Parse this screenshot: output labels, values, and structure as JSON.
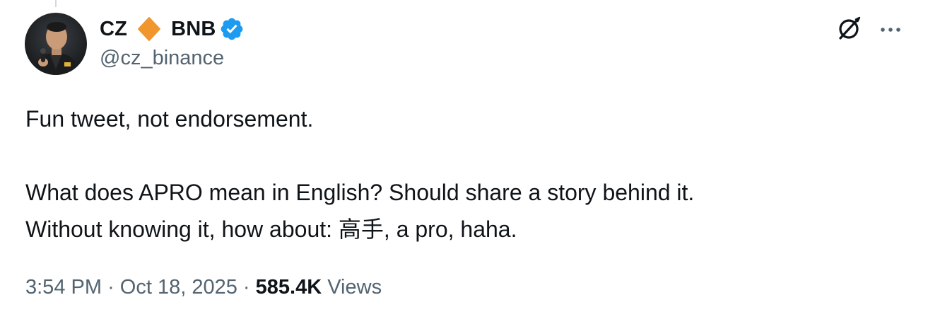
{
  "author": {
    "display_name_left": "CZ",
    "display_name_right": "BNB",
    "handle": "@cz_binance",
    "avatar_icon": "avatar-photo",
    "name_badge_icon": "orange-diamond-icon",
    "verified_icon": "verified-badge-icon"
  },
  "actions": {
    "grok_icon": "grok-icon",
    "more_icon": "more-options-icon"
  },
  "tweet": {
    "line1": "Fun tweet, not endorsement.",
    "line2": "What does APRO mean in English? Should share a story behind it.",
    "line3": "Without knowing it, how about: 高手, a pro, haha."
  },
  "meta": {
    "time": "3:54 PM",
    "separator": "·",
    "date": "Oct 18, 2025",
    "views_count": "585.4K",
    "views_label": "Views"
  },
  "colors": {
    "text_primary": "#0f1419",
    "text_secondary": "#536471",
    "verified_blue": "#1d9bf0",
    "diamond_orange": "#f0962d"
  }
}
